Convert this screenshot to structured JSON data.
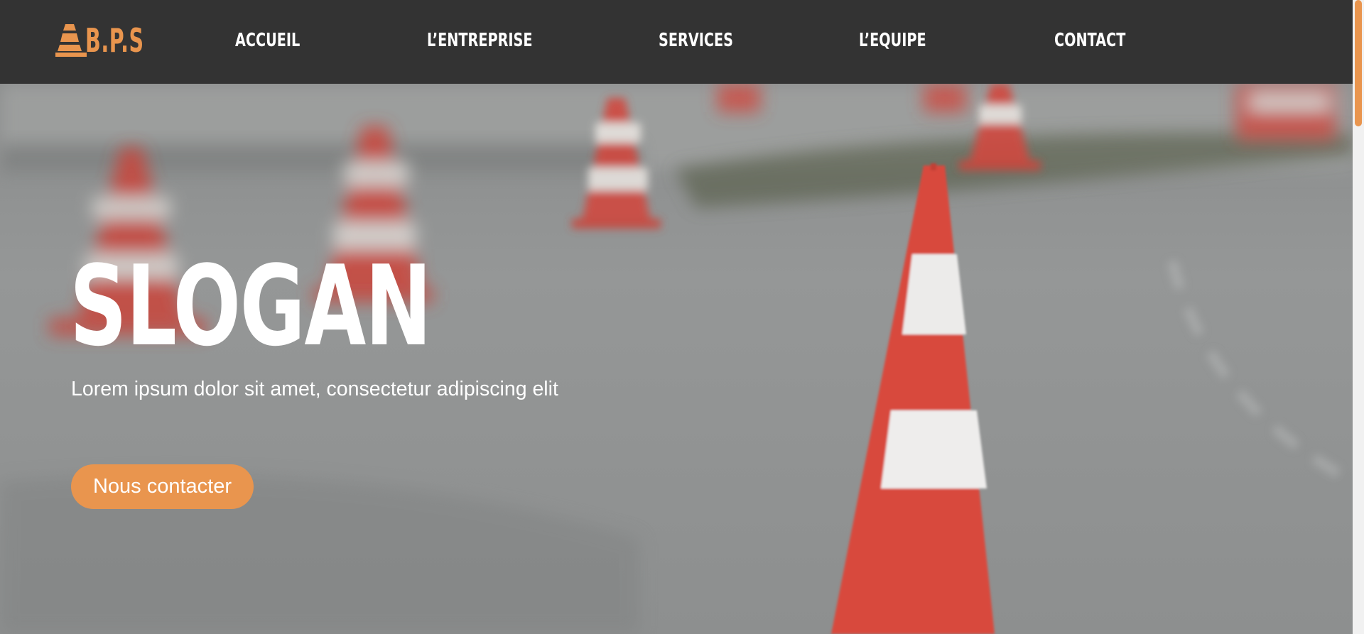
{
  "brand": {
    "logo_text": "B.P.S",
    "logo_icon": "traffic-cone-icon",
    "accent_color": "#e9954e",
    "nav_background": "#333333"
  },
  "nav": {
    "items": [
      {
        "label": "ACCUEIL"
      },
      {
        "label": "L’ENTREPRISE"
      },
      {
        "label": "SERVICES"
      },
      {
        "label": "L’EQUIPE"
      },
      {
        "label": "CONTACT"
      }
    ]
  },
  "hero": {
    "title": "SLOGAN",
    "subtitle": "Lorem ipsum dolor sit amet, consectetur adipiscing elit",
    "cta_label": "Nous contacter",
    "background": "road-with-traffic-cones-photo"
  }
}
